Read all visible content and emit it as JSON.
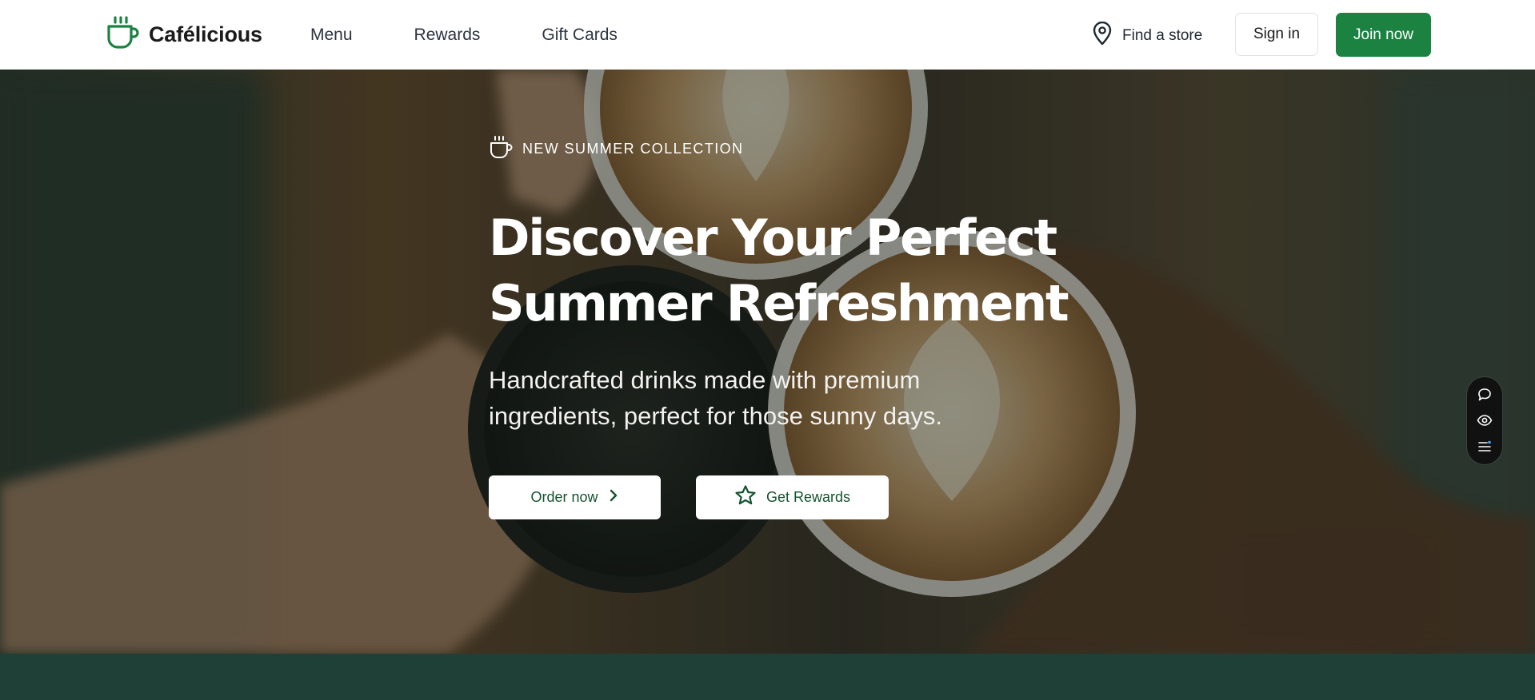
{
  "header": {
    "brand": "Cafélicious",
    "nav": [
      {
        "label": "Menu"
      },
      {
        "label": "Rewards"
      },
      {
        "label": "Gift Cards"
      }
    ],
    "find_store": "Find a store",
    "sign_in": "Sign in",
    "join_now": "Join now"
  },
  "hero": {
    "badge": "NEW SUMMER COLLECTION",
    "headline_line1": "Discover Your Perfect",
    "headline_line2": "Summer Refreshment",
    "subtext_line1": "Handcrafted drinks made with premium",
    "subtext_line2": "ingredients, perfect for those sunny days.",
    "order_now": "Order now",
    "get_rewards": "Get Rewards"
  },
  "colors": {
    "brand_green": "#1b8242",
    "button_text_green": "#14532d",
    "footer_band": "#1f4037"
  },
  "icons": {
    "logo": "coffee-cup-icon",
    "find_store": "map-pin-icon",
    "badge": "coffee-cup-icon",
    "order_now": "chevron-right-icon",
    "get_rewards": "star-icon",
    "tools": [
      "comment-icon",
      "eye-icon",
      "list-icon"
    ]
  }
}
